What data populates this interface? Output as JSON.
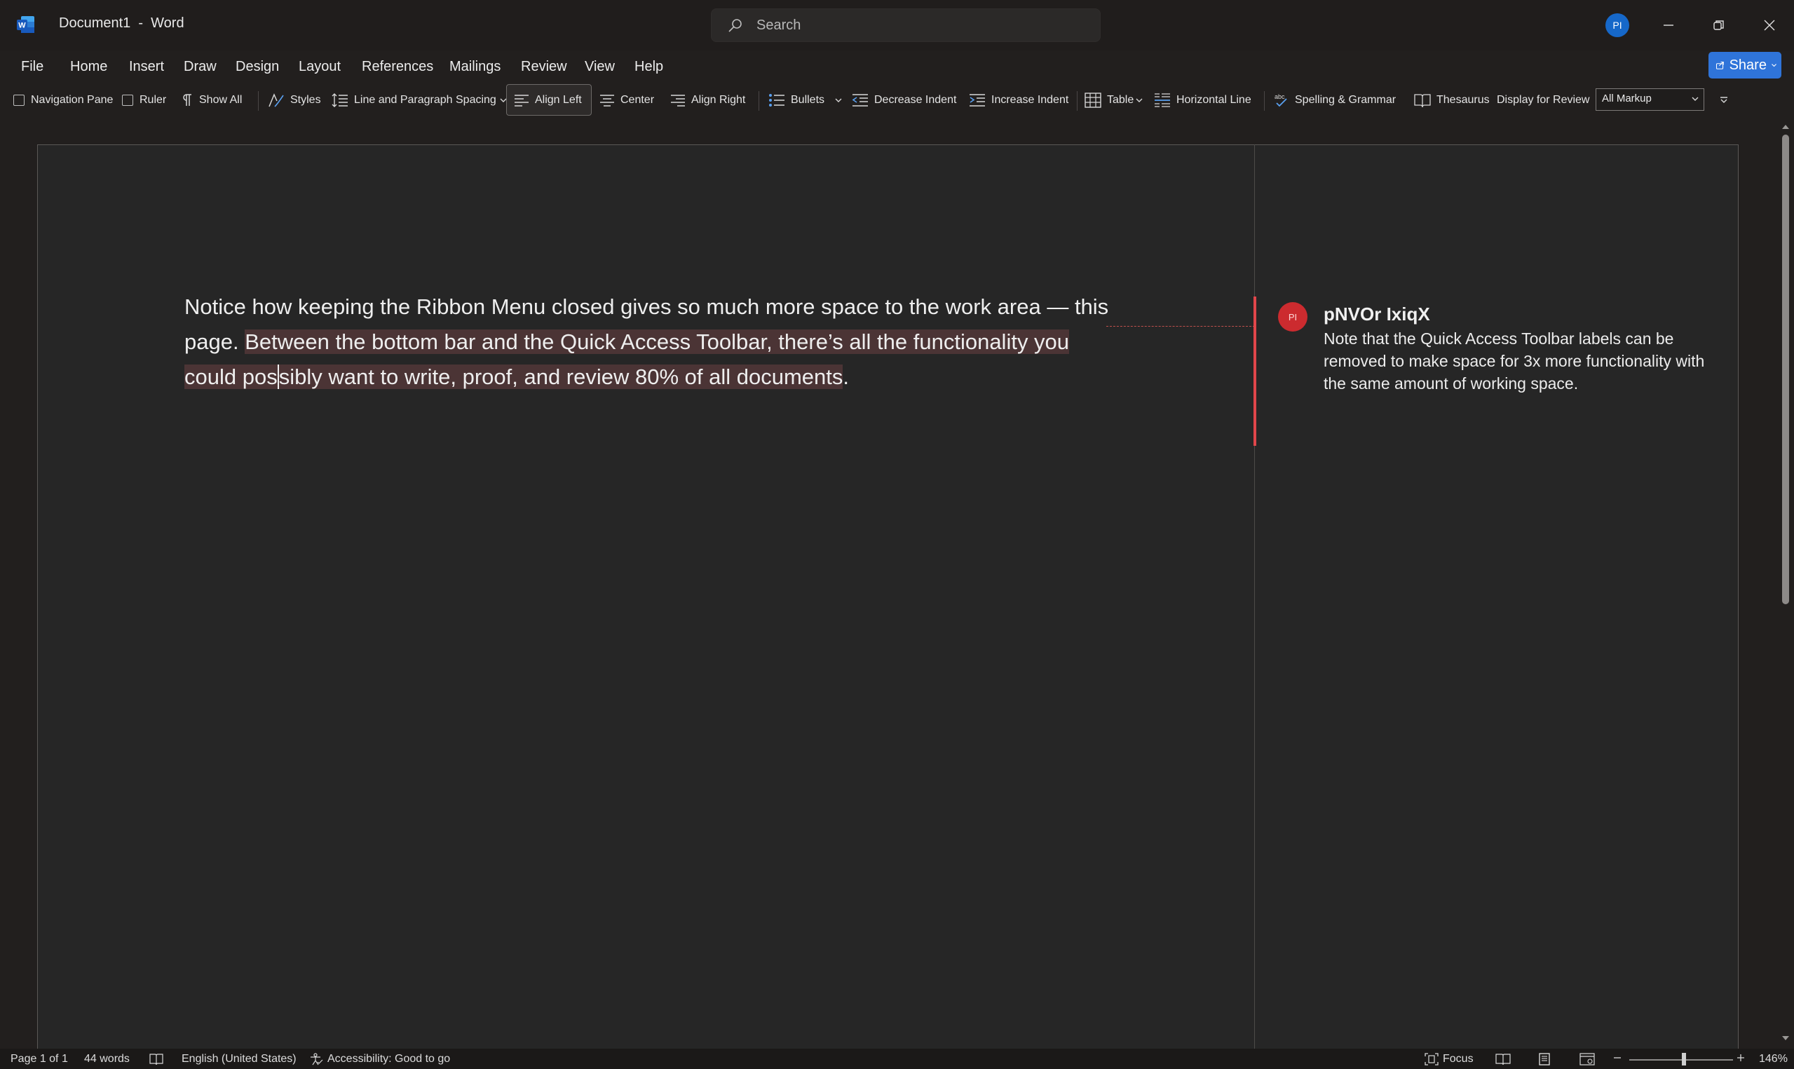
{
  "window": {
    "app_title": "Document1  -  Word",
    "search_placeholder": "Search",
    "user_initials": "PI"
  },
  "menu": {
    "items": [
      "File",
      "Home",
      "Insert",
      "Draw",
      "Design",
      "Layout",
      "References",
      "Mailings",
      "Review",
      "View",
      "Help"
    ],
    "share_label": "Share"
  },
  "toolbar": {
    "navigation_pane": "Navigation Pane",
    "ruler": "Ruler",
    "show_all": "Show All",
    "styles": "Styles",
    "line_spacing": "Line and Paragraph Spacing",
    "align_left": "Align Left",
    "center": "Center",
    "align_right": "Align Right",
    "bullets": "Bullets",
    "decrease_indent": "Decrease Indent",
    "increase_indent": "Increase Indent",
    "table": "Table",
    "horizontal_line": "Horizontal Line",
    "spelling": "Spelling & Grammar",
    "thesaurus": "Thesaurus",
    "display_for_review": "Display for Review",
    "markup_value": "All Markup"
  },
  "document": {
    "text_before": "Notice how keeping the Ribbon Menu closed gives so much more space to the work area — this page. ",
    "highlight_part1": "Between the bottom bar and the Quick Access Toolbar, there’s all the functionality you could pos",
    "highlight_part2": "sibly want to write, proof, and review 80% of all documents",
    "text_after": "."
  },
  "comment": {
    "initials": "PI",
    "author": "pNVOr IxiqX",
    "text": "Note that the Quick Access Toolbar labels can be removed to make space for 3x more functionality with the same amount of working space.",
    "accent_color": "#e0464a"
  },
  "status": {
    "page": "Page 1 of 1",
    "words": "44 words",
    "language": "English (United States)",
    "accessibility": "Accessibility: Good to go",
    "focus": "Focus",
    "zoom": "146%"
  },
  "colors": {
    "share": "#2f74d9",
    "avatar": "#1668c9",
    "highlight": "#4b3435"
  }
}
